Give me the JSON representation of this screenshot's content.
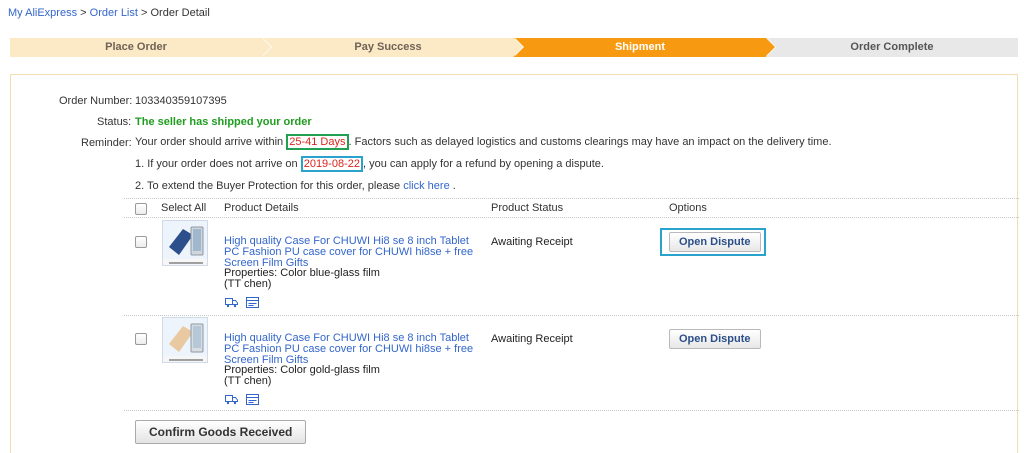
{
  "breadcrumb": {
    "home": "My AliExpress",
    "sep": ">",
    "order_list": "Order List",
    "current": "Order Detail"
  },
  "steps": [
    {
      "label": "Place Order",
      "state": "done"
    },
    {
      "label": "Pay Success",
      "state": "done"
    },
    {
      "label": "Shipment",
      "state": "active"
    },
    {
      "label": "Order Complete",
      "state": "todo"
    }
  ],
  "order": {
    "number_label": "Order Number:",
    "number": "103340359107395",
    "status_label": "Status:",
    "status": "The seller has shipped your order",
    "reminder_label": "Reminder:",
    "reminder_pre": "Your order should arrive within ",
    "reminder_days": "25-41 Days",
    "reminder_post": ". Factors such as delayed logistics and customs clearings may have an impact on the delivery time.",
    "note1_pre": "1. If your order does not arrive on ",
    "note1_date": "2019-08-22",
    "note1_post": ", you can apply for a refund by opening a dispute.",
    "note2_pre": "2. To extend the Buyer Protection for this order, please ",
    "note2_link": "click here",
    "note2_post": " ."
  },
  "table": {
    "select_all": "Select All",
    "col_details": "Product Details",
    "col_status": "Product Status",
    "col_options": "Options"
  },
  "products": [
    {
      "title": "High quality Case For CHUWI Hi8 se 8 inch Tablet PC Fashion PU case cover for CHUWI hi8se + free Screen Film Gifts",
      "properties": "Properties: Color blue-glass film",
      "seller": "(TT chen)",
      "status": "Awaiting Receipt",
      "button": "Open Dispute"
    },
    {
      "title": "High quality Case For CHUWI Hi8 se 8 inch Tablet PC Fashion PU case cover for CHUWI hi8se + free Screen Film Gifts",
      "properties": "Properties: Color gold-glass film",
      "seller": "(TT chen)",
      "status": "Awaiting Receipt",
      "button": "Open Dispute"
    }
  ],
  "confirm_button": "Confirm Goods Received",
  "colors": {
    "step_done": "#fce9c5",
    "step_active": "#f79a11",
    "step_todo": "#e8e8e8",
    "status_green": "#1f9d1f",
    "highlight_red": "#d9261c",
    "box_green": "#20a050",
    "box_blue": "#29a3cc",
    "link_blue": "#3366cc"
  },
  "icons": [
    "tracking-truck-icon",
    "invoice-card-icon",
    "tablet-case-product-icon"
  ]
}
